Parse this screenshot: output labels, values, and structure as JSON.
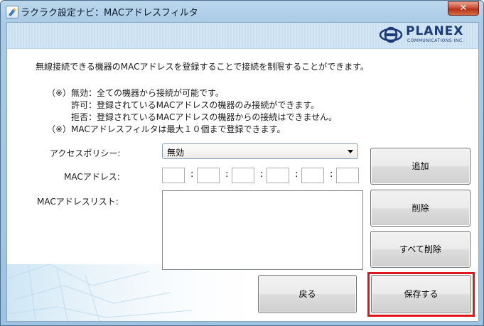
{
  "window": {
    "title": "ラクラク設定ナビ：MACアドレスフィルタ",
    "close_glyph": "✕"
  },
  "logo": {
    "brand": "PLANEX",
    "sub": "COMMUNICATIONS INC."
  },
  "intro": "無線接続できる機器のMACアドレスを登録することで接続を制限することができます。",
  "notes": {
    "note1": "（※）無効：全ての機器から接続が可能です。",
    "allow": "許可：登録されているMACアドレスの機器のみ接続ができます。",
    "deny": "拒否：登録されているMACアドレスの機器からの接続はできません。",
    "note2": "（※）MACアドレスフィルタは最大１０個まで登録できます。"
  },
  "form": {
    "policy_label": "アクセスポリシー:",
    "policy_value": "無効",
    "mac_label": "MACアドレス:",
    "mac_octets": [
      "",
      "",
      "",
      "",
      "",
      ""
    ],
    "separator": ":",
    "list_label": "MACアドレスリスト:"
  },
  "buttons": {
    "add": "追加",
    "delete": "削除",
    "delete_all": "すべて削除",
    "back": "戻る",
    "save": "保存する"
  },
  "colors": {
    "highlight": "#e0161b",
    "brand": "#1b3a78"
  }
}
